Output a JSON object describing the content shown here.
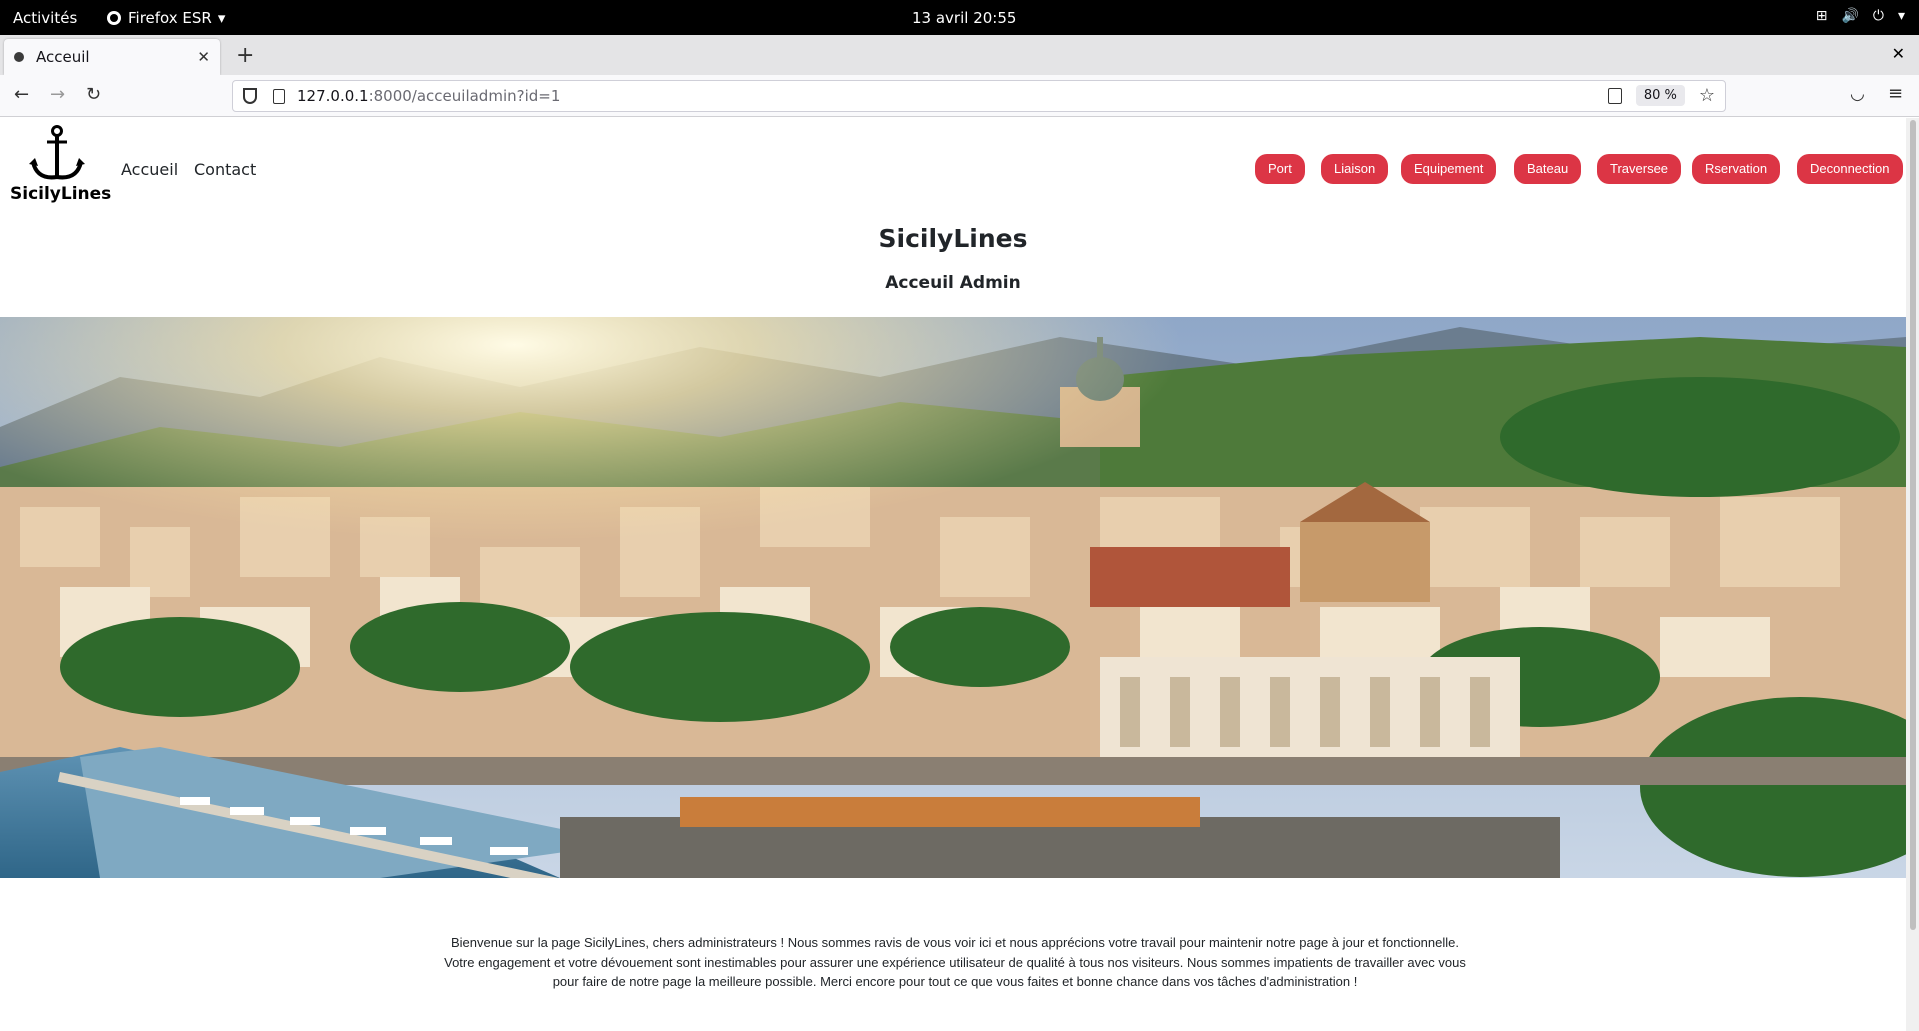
{
  "system_bar": {
    "activities": "Activités",
    "app_name": "Firefox ESR",
    "clock": "13 avril  20:55"
  },
  "browser": {
    "tab_title": "Acceuil",
    "url_host": "127.0.0.1",
    "url_rest": ":8000/acceuiladmin?id=1",
    "zoom": "80 %"
  },
  "site": {
    "brand": "SicilyLines",
    "nav_links": [
      "Accueil",
      "Contact"
    ],
    "admin_buttons": [
      "Port",
      "Liaison",
      "Equipement",
      "Bateau",
      "Traversee",
      "Rservation",
      "Deconnection"
    ],
    "accent_color": "#dc3545",
    "page_title": "SicilyLines",
    "page_subtitle": "Acceuil Admin",
    "welcome_text": "Bienvenue sur la page SicilyLines, chers administrateurs ! Nous sommes ravis de vous voir ici et nous apprécions votre travail pour maintenir notre page à jour et fonctionnelle. Votre engagement et votre dévouement sont inestimables pour assurer une expérience utilisateur de qualité à tous nos visiteurs. Nous sommes impatients de travailler avec vous pour faire de notre page la meilleure possible. Merci encore pour tout ce que vous faites et bonne chance dans vos tâches d'administration !"
  }
}
